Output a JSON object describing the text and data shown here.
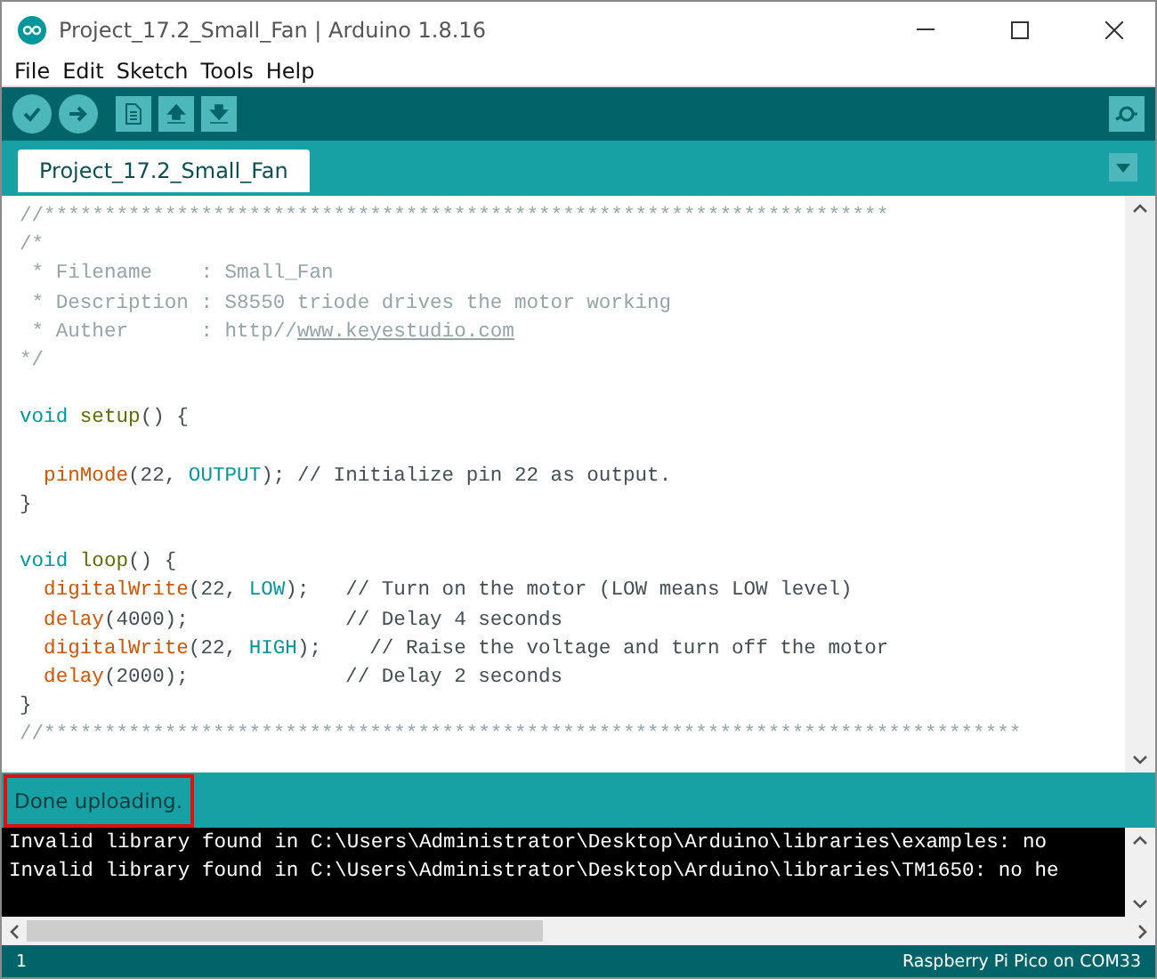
{
  "window": {
    "title": "Project_17.2_Small_Fan | Arduino 1.8.16"
  },
  "menu": [
    "File",
    "Edit",
    "Sketch",
    "Tools",
    "Help"
  ],
  "tabs": [
    {
      "label": "Project_17.2_Small_Fan",
      "selected": true
    }
  ],
  "code_lines": [
    {
      "kind": "code",
      "tokens": [
        {
          "kind": "comment",
          "text": "//**********************************************************************"
        }
      ]
    },
    {
      "kind": "code",
      "tokens": [
        {
          "kind": "doc",
          "text": "/*"
        }
      ]
    },
    {
      "kind": "code",
      "tokens": [
        {
          "kind": "doc",
          "text": " * Filename    : Small_Fan"
        }
      ]
    },
    {
      "kind": "code",
      "tokens": [
        {
          "kind": "doc",
          "text": " * Description : S8550 triode drives the motor working"
        }
      ]
    },
    {
      "kind": "code",
      "tokens": [
        {
          "kind": "doc",
          "text": " * Auther      : http//"
        },
        {
          "kind": "link",
          "text": "www.keyestudio.com"
        }
      ]
    },
    {
      "kind": "code",
      "tokens": [
        {
          "kind": "doc",
          "text": "*/"
        }
      ]
    },
    {
      "kind": "blank"
    },
    {
      "kind": "code",
      "tokens": [
        {
          "kind": "keyword",
          "text": "void "
        },
        {
          "kind": "entry",
          "text": "setup"
        },
        {
          "kind": "plain",
          "text": "() {"
        }
      ]
    },
    {
      "kind": "blank"
    },
    {
      "kind": "code",
      "tokens": [
        {
          "kind": "function",
          "text": "  pinMode"
        },
        {
          "kind": "plain",
          "text": "(22, "
        },
        {
          "kind": "keyword",
          "text": "OUTPUT"
        },
        {
          "kind": "plain",
          "text": "); // Initialize pin 22 as output."
        }
      ]
    },
    {
      "kind": "code",
      "tokens": [
        {
          "kind": "plain",
          "text": "}"
        }
      ]
    },
    {
      "kind": "blank"
    },
    {
      "kind": "code",
      "tokens": [
        {
          "kind": "keyword",
          "text": "void "
        },
        {
          "kind": "entry",
          "text": "loop"
        },
        {
          "kind": "plain",
          "text": "() {"
        }
      ]
    },
    {
      "kind": "code",
      "tokens": [
        {
          "kind": "function",
          "text": "  digitalWrite"
        },
        {
          "kind": "plain",
          "text": "(22, "
        },
        {
          "kind": "keyword",
          "text": "LOW"
        },
        {
          "kind": "plain",
          "text": ");   // Turn on the motor (LOW means LOW level)"
        }
      ]
    },
    {
      "kind": "code",
      "tokens": [
        {
          "kind": "function",
          "text": "  delay"
        },
        {
          "kind": "plain",
          "text": "(4000);             // Delay 4 seconds"
        }
      ]
    },
    {
      "kind": "code",
      "tokens": [
        {
          "kind": "function",
          "text": "  digitalWrite"
        },
        {
          "kind": "plain",
          "text": "(22, "
        },
        {
          "kind": "keyword",
          "text": "HIGH"
        },
        {
          "kind": "plain",
          "text": ");    // Raise the voltage and turn off the motor"
        }
      ]
    },
    {
      "kind": "code",
      "tokens": [
        {
          "kind": "function",
          "text": "  delay"
        },
        {
          "kind": "plain",
          "text": "(2000);             // Delay 2 seconds"
        }
      ]
    },
    {
      "kind": "code",
      "tokens": [
        {
          "kind": "plain",
          "text": "}"
        }
      ]
    },
    {
      "kind": "code",
      "tokens": [
        {
          "kind": "comment",
          "text": "//*********************************************************************************"
        }
      ]
    }
  ],
  "status_message": "Done uploading.",
  "console_lines": [
    "Invalid library found in C:\\Users\\Administrator\\Desktop\\Arduino\\libraries\\examples: no",
    "Invalid library found in C:\\Users\\Administrator\\Desktop\\Arduino\\libraries\\TM1650: no he"
  ],
  "status_bar": {
    "line": "1",
    "board": "Raspberry Pi Pico on COM33"
  }
}
